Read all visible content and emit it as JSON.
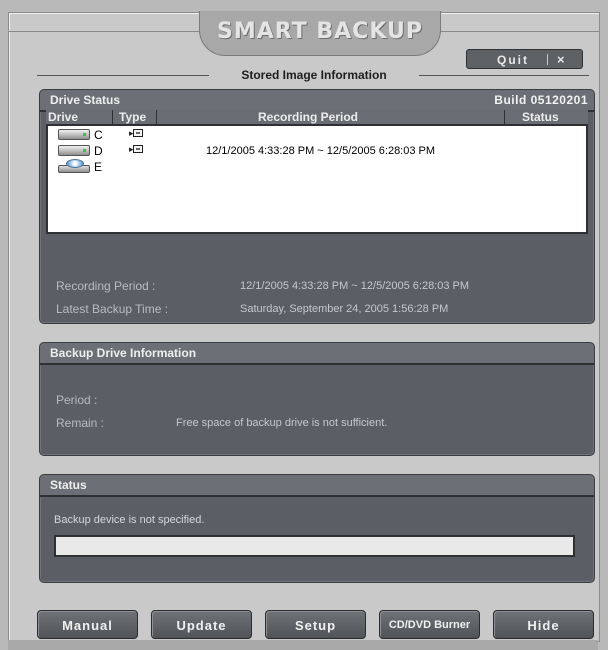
{
  "app": {
    "title": "SMART BACKUP",
    "quit_label": "Quit",
    "close_label": "×",
    "section_title": "Stored Image Information"
  },
  "drive_status": {
    "title": "Drive Status",
    "build": "Build 05120201",
    "columns": [
      "Drive",
      "Type",
      "Recording Period",
      "Status"
    ],
    "rows": [
      {
        "icon": "hard-drive-icon",
        "letter": "C",
        "type_icon": "camera-icon",
        "period": "",
        "status": ""
      },
      {
        "icon": "hard-drive-icon",
        "letter": "D",
        "type_icon": "camera-icon",
        "period": "12/1/2005 4:33:28 PM  ~ 12/5/2005 6:28:03 PM",
        "status": ""
      },
      {
        "icon": "cd-drive-icon",
        "letter": "E",
        "type_icon": "",
        "period": "",
        "status": ""
      }
    ],
    "recording_period_label": "Recording Period :",
    "recording_period_value": "12/1/2005 4:33:28 PM  ~ 12/5/2005 6:28:03 PM",
    "latest_backup_label": "Latest Backup Time :",
    "latest_backup_value": "Saturday, September 24, 2005 1:56:28 PM"
  },
  "backup_drive": {
    "title": "Backup Drive Information",
    "period_label": "Period :",
    "period_value": "",
    "remain_label": "Remain :",
    "remain_value": "Free space of backup drive is not sufficient."
  },
  "status": {
    "title": "Status",
    "message": "Backup device is not specified.",
    "progress": 0
  },
  "buttons": {
    "manual": "Manual",
    "update": "Update",
    "setup": "Setup",
    "cddvd": "CD/DVD Burner",
    "hide": "Hide"
  },
  "colors": {
    "panel": "#5b5f65",
    "window": "#c9c9c9",
    "list_bg": "#ffffff"
  }
}
